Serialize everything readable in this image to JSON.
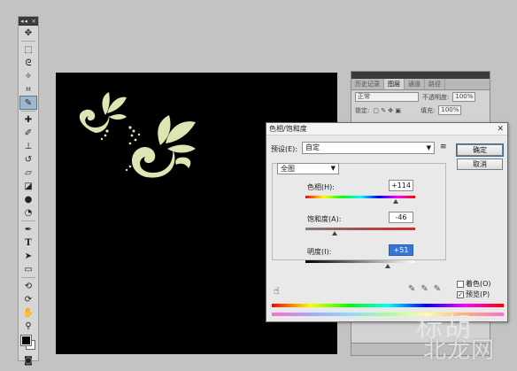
{
  "toolbox": {
    "header": "◂◂ ×"
  },
  "layers_panel": {
    "tabs": [
      "历史记录",
      "图层",
      "通道",
      "路径"
    ],
    "blend_mode": "正常",
    "opacity_label": "不透明度:",
    "opacity_value": "100%",
    "lock_label": "锁定:",
    "fill_label": "填充:",
    "fill_value": "100%"
  },
  "dialog": {
    "title": "色相/饱和度",
    "preset_label": "预设(E):",
    "preset_value": "自定",
    "ok_label": "确定",
    "cancel_label": "取消",
    "channel": "全图",
    "hue_label": "色相(H):",
    "hue_value": "+114",
    "hue_level": 0.82,
    "saturation_label": "饱和度(A):",
    "saturation_value": "-46",
    "saturation_level": 0.27,
    "lightness_label": "明度(I):",
    "lightness_value": "+51",
    "lightness_level": 0.75,
    "colorize_label": "着色(O)",
    "preview_label": "预览(P)",
    "colorize_checked": false,
    "preview_checked": true
  },
  "watermark": {
    "line1": "标胡",
    "line2": "北龙网"
  },
  "colors": {
    "ornament": "#dde6b2",
    "accent_blue": "#3875d7"
  }
}
